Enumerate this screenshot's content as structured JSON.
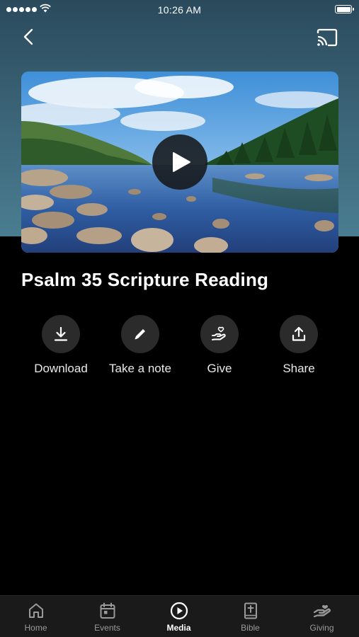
{
  "status_bar": {
    "time": "10:26 AM"
  },
  "nav": {
    "back_icon": "chevron-left-icon",
    "cast_icon": "cast-icon"
  },
  "media": {
    "thumbnail": "lake-landscape-image",
    "play_icon": "play-icon"
  },
  "title": "Psalm 35 Scripture Reading",
  "actions": [
    {
      "label": "Download",
      "icon": "download-icon"
    },
    {
      "label": "Take a note",
      "icon": "pencil-icon"
    },
    {
      "label": "Give",
      "icon": "hand-heart-icon"
    },
    {
      "label": "Share",
      "icon": "share-icon"
    }
  ],
  "tabs": [
    {
      "label": "Home",
      "icon": "home-icon",
      "active": false
    },
    {
      "label": "Events",
      "icon": "calendar-icon",
      "active": false
    },
    {
      "label": "Media",
      "icon": "play-circle-icon",
      "active": true
    },
    {
      "label": "Bible",
      "icon": "bible-icon",
      "active": false
    },
    {
      "label": "Giving",
      "icon": "giving-hand-icon",
      "active": false
    }
  ],
  "colors": {
    "header_gradient_top": "#2a4a5c",
    "header_gradient_bottom": "#4a7d91",
    "background": "#000000",
    "action_circle": "#2b2b2b",
    "tab_bar": "#1a1a1a",
    "tab_inactive": "#9a9a9a",
    "tab_active": "#ffffff"
  }
}
